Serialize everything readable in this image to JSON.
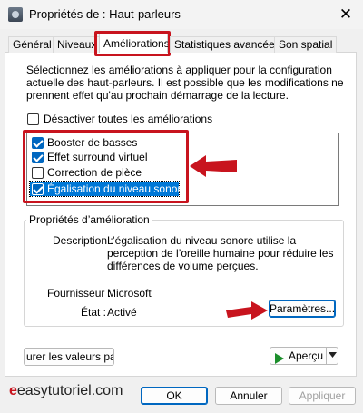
{
  "window": {
    "title": "Propriétés de : Haut-parleurs",
    "close_glyph": "✕"
  },
  "tabs": [
    {
      "label": "Général"
    },
    {
      "label": "Niveaux"
    },
    {
      "label": "Améliorations"
    },
    {
      "label": "Statistiques avancées"
    },
    {
      "label": "Son spatial"
    }
  ],
  "main": {
    "description": "Sélectionnez les améliorations à appliquer pour la configuration actuelle des haut-parleurs. Il est possible que les modifications ne prennent effet qu'au prochain démarrage de la lecture.",
    "disable_all": {
      "label": "Désactiver toutes les améliorations",
      "checked": false
    },
    "enhancements": [
      {
        "label": "Booster de basses",
        "checked": true
      },
      {
        "label": "Effet surround virtuel",
        "checked": true
      },
      {
        "label": "Correction de pièce",
        "checked": false
      },
      {
        "label": "Égalisation du niveau sonore",
        "checked": true,
        "selected": true
      }
    ],
    "properties": {
      "group_title": "Propriétés d’amélioration",
      "description_label": "Description :",
      "description_value": "L’égalisation du niveau sonore utilise la perception de l’oreille humaine pour réduire les différences de volume perçues.",
      "provider_label": "Fournisseur :",
      "provider_value": "Microsoft",
      "status_label": "État :",
      "status_value": "Activé",
      "settings_button": "Paramètres..."
    },
    "restore_button": "urer les valeurs par d",
    "preview_button": "Aperçu"
  },
  "footer": {
    "logo_mark": "e",
    "logo_text": "easytutoriel.com",
    "ok_button": "OK",
    "cancel_button": "Annuler",
    "apply_button": "Appliquer"
  },
  "colors": {
    "accent": "#0067c0",
    "annotation_red": "#c8141e",
    "preview_play": "#1b8e2b"
  }
}
